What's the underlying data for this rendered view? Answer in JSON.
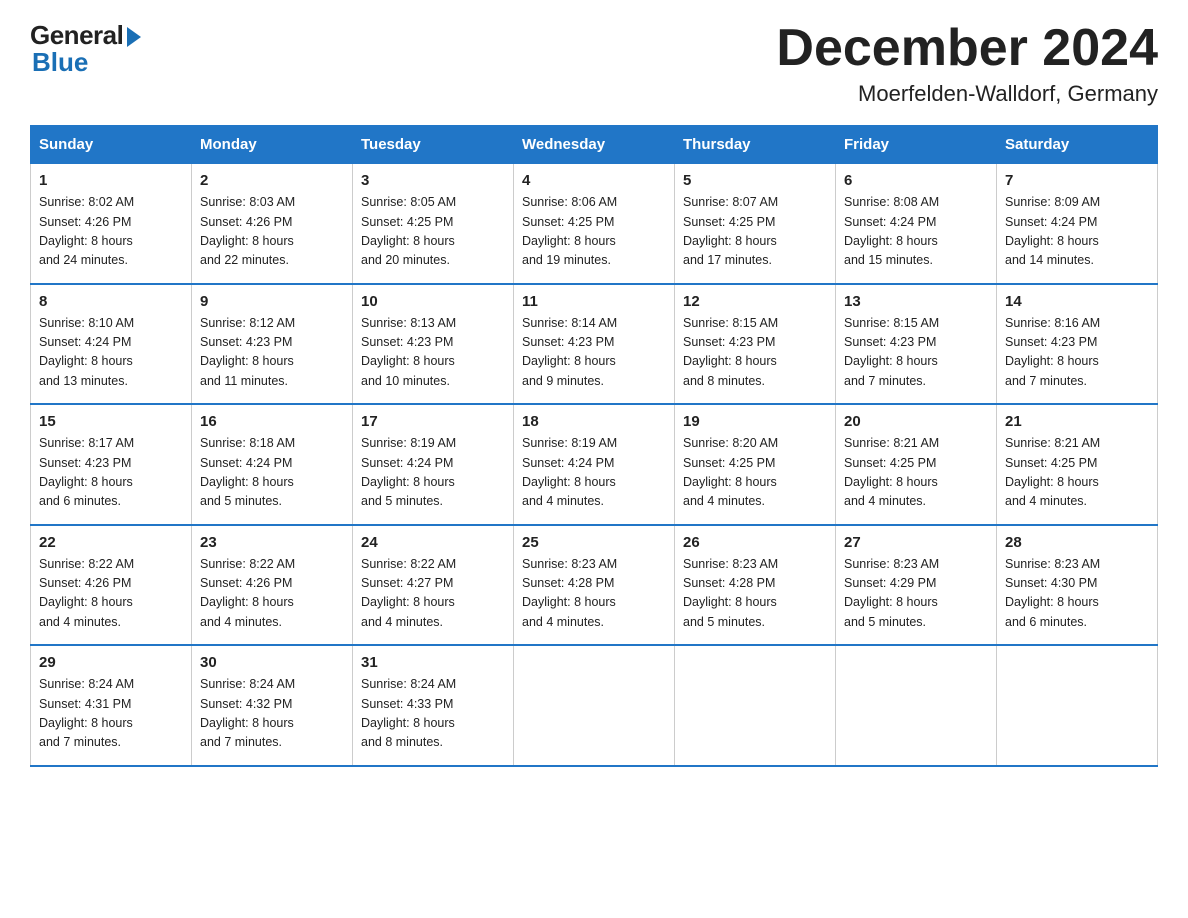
{
  "logo": {
    "general": "General",
    "blue": "Blue"
  },
  "title": "December 2024",
  "location": "Moerfelden-Walldorf, Germany",
  "days_of_week": [
    "Sunday",
    "Monday",
    "Tuesday",
    "Wednesday",
    "Thursday",
    "Friday",
    "Saturday"
  ],
  "weeks": [
    [
      {
        "day": "1",
        "info": "Sunrise: 8:02 AM\nSunset: 4:26 PM\nDaylight: 8 hours\nand 24 minutes."
      },
      {
        "day": "2",
        "info": "Sunrise: 8:03 AM\nSunset: 4:26 PM\nDaylight: 8 hours\nand 22 minutes."
      },
      {
        "day": "3",
        "info": "Sunrise: 8:05 AM\nSunset: 4:25 PM\nDaylight: 8 hours\nand 20 minutes."
      },
      {
        "day": "4",
        "info": "Sunrise: 8:06 AM\nSunset: 4:25 PM\nDaylight: 8 hours\nand 19 minutes."
      },
      {
        "day": "5",
        "info": "Sunrise: 8:07 AM\nSunset: 4:25 PM\nDaylight: 8 hours\nand 17 minutes."
      },
      {
        "day": "6",
        "info": "Sunrise: 8:08 AM\nSunset: 4:24 PM\nDaylight: 8 hours\nand 15 minutes."
      },
      {
        "day": "7",
        "info": "Sunrise: 8:09 AM\nSunset: 4:24 PM\nDaylight: 8 hours\nand 14 minutes."
      }
    ],
    [
      {
        "day": "8",
        "info": "Sunrise: 8:10 AM\nSunset: 4:24 PM\nDaylight: 8 hours\nand 13 minutes."
      },
      {
        "day": "9",
        "info": "Sunrise: 8:12 AM\nSunset: 4:23 PM\nDaylight: 8 hours\nand 11 minutes."
      },
      {
        "day": "10",
        "info": "Sunrise: 8:13 AM\nSunset: 4:23 PM\nDaylight: 8 hours\nand 10 minutes."
      },
      {
        "day": "11",
        "info": "Sunrise: 8:14 AM\nSunset: 4:23 PM\nDaylight: 8 hours\nand 9 minutes."
      },
      {
        "day": "12",
        "info": "Sunrise: 8:15 AM\nSunset: 4:23 PM\nDaylight: 8 hours\nand 8 minutes."
      },
      {
        "day": "13",
        "info": "Sunrise: 8:15 AM\nSunset: 4:23 PM\nDaylight: 8 hours\nand 7 minutes."
      },
      {
        "day": "14",
        "info": "Sunrise: 8:16 AM\nSunset: 4:23 PM\nDaylight: 8 hours\nand 7 minutes."
      }
    ],
    [
      {
        "day": "15",
        "info": "Sunrise: 8:17 AM\nSunset: 4:23 PM\nDaylight: 8 hours\nand 6 minutes."
      },
      {
        "day": "16",
        "info": "Sunrise: 8:18 AM\nSunset: 4:24 PM\nDaylight: 8 hours\nand 5 minutes."
      },
      {
        "day": "17",
        "info": "Sunrise: 8:19 AM\nSunset: 4:24 PM\nDaylight: 8 hours\nand 5 minutes."
      },
      {
        "day": "18",
        "info": "Sunrise: 8:19 AM\nSunset: 4:24 PM\nDaylight: 8 hours\nand 4 minutes."
      },
      {
        "day": "19",
        "info": "Sunrise: 8:20 AM\nSunset: 4:25 PM\nDaylight: 8 hours\nand 4 minutes."
      },
      {
        "day": "20",
        "info": "Sunrise: 8:21 AM\nSunset: 4:25 PM\nDaylight: 8 hours\nand 4 minutes."
      },
      {
        "day": "21",
        "info": "Sunrise: 8:21 AM\nSunset: 4:25 PM\nDaylight: 8 hours\nand 4 minutes."
      }
    ],
    [
      {
        "day": "22",
        "info": "Sunrise: 8:22 AM\nSunset: 4:26 PM\nDaylight: 8 hours\nand 4 minutes."
      },
      {
        "day": "23",
        "info": "Sunrise: 8:22 AM\nSunset: 4:26 PM\nDaylight: 8 hours\nand 4 minutes."
      },
      {
        "day": "24",
        "info": "Sunrise: 8:22 AM\nSunset: 4:27 PM\nDaylight: 8 hours\nand 4 minutes."
      },
      {
        "day": "25",
        "info": "Sunrise: 8:23 AM\nSunset: 4:28 PM\nDaylight: 8 hours\nand 4 minutes."
      },
      {
        "day": "26",
        "info": "Sunrise: 8:23 AM\nSunset: 4:28 PM\nDaylight: 8 hours\nand 5 minutes."
      },
      {
        "day": "27",
        "info": "Sunrise: 8:23 AM\nSunset: 4:29 PM\nDaylight: 8 hours\nand 5 minutes."
      },
      {
        "day": "28",
        "info": "Sunrise: 8:23 AM\nSunset: 4:30 PM\nDaylight: 8 hours\nand 6 minutes."
      }
    ],
    [
      {
        "day": "29",
        "info": "Sunrise: 8:24 AM\nSunset: 4:31 PM\nDaylight: 8 hours\nand 7 minutes."
      },
      {
        "day": "30",
        "info": "Sunrise: 8:24 AM\nSunset: 4:32 PM\nDaylight: 8 hours\nand 7 minutes."
      },
      {
        "day": "31",
        "info": "Sunrise: 8:24 AM\nSunset: 4:33 PM\nDaylight: 8 hours\nand 8 minutes."
      },
      {
        "day": "",
        "info": ""
      },
      {
        "day": "",
        "info": ""
      },
      {
        "day": "",
        "info": ""
      },
      {
        "day": "",
        "info": ""
      }
    ]
  ]
}
